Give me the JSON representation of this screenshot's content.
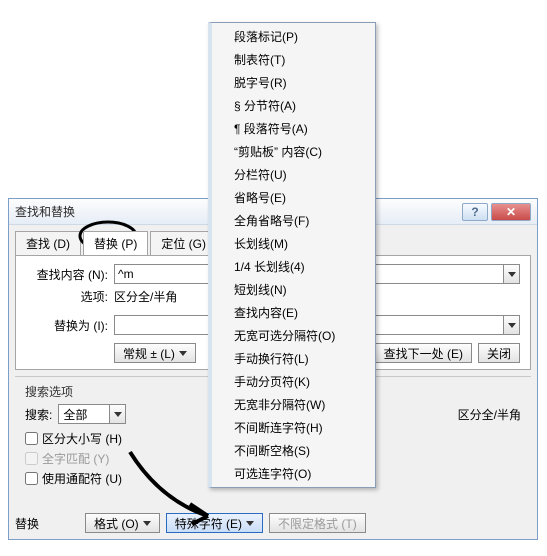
{
  "dialog": {
    "title": "查找和替换",
    "help_label": "?",
    "close_label": "✕"
  },
  "tabs": {
    "find": "查找 (D)",
    "replace": "替换 (P)",
    "goto": "定位 (G)"
  },
  "fields": {
    "find_label": "查找内容 (N):",
    "find_value": "^m",
    "options_label": "选项:",
    "options_value": "区分全/半角",
    "replace_label": "替换为 (I):",
    "replace_value": ""
  },
  "buttons": {
    "less": "常规 ± (L)",
    "findnext": "查找下一处 (E)",
    "close": "关闭",
    "format": "格式 (O)",
    "special": "特殊字符 (E)",
    "noformat": "不限定格式 (T)"
  },
  "search_options": {
    "group_title": "搜索选项",
    "search_label": "搜索:",
    "scope": "全部",
    "case": "区分大小写 (H)",
    "whole": "全字匹配 (Y)",
    "wildcard": "使用通配符 (U)",
    "right_note": "区分全/半角"
  },
  "replace_section": "替换",
  "menu": [
    "段落标记(P)",
    "制表符(T)",
    "脱字号(R)",
    "§ 分节符(A)",
    "¶ 段落符号(A)",
    "“剪贴板” 内容(C)",
    "分栏符(U)",
    "省略号(E)",
    "全角省略号(F)",
    "长划线(M)",
    "1/4 长划线(4)",
    "短划线(N)",
    "查找内容(E)",
    "无宽可选分隔符(O)",
    "手动换行符(L)",
    "手动分页符(K)",
    "无宽非分隔符(W)",
    "不间断连字符(H)",
    "不间断空格(S)",
    "可选连字符(O)"
  ]
}
